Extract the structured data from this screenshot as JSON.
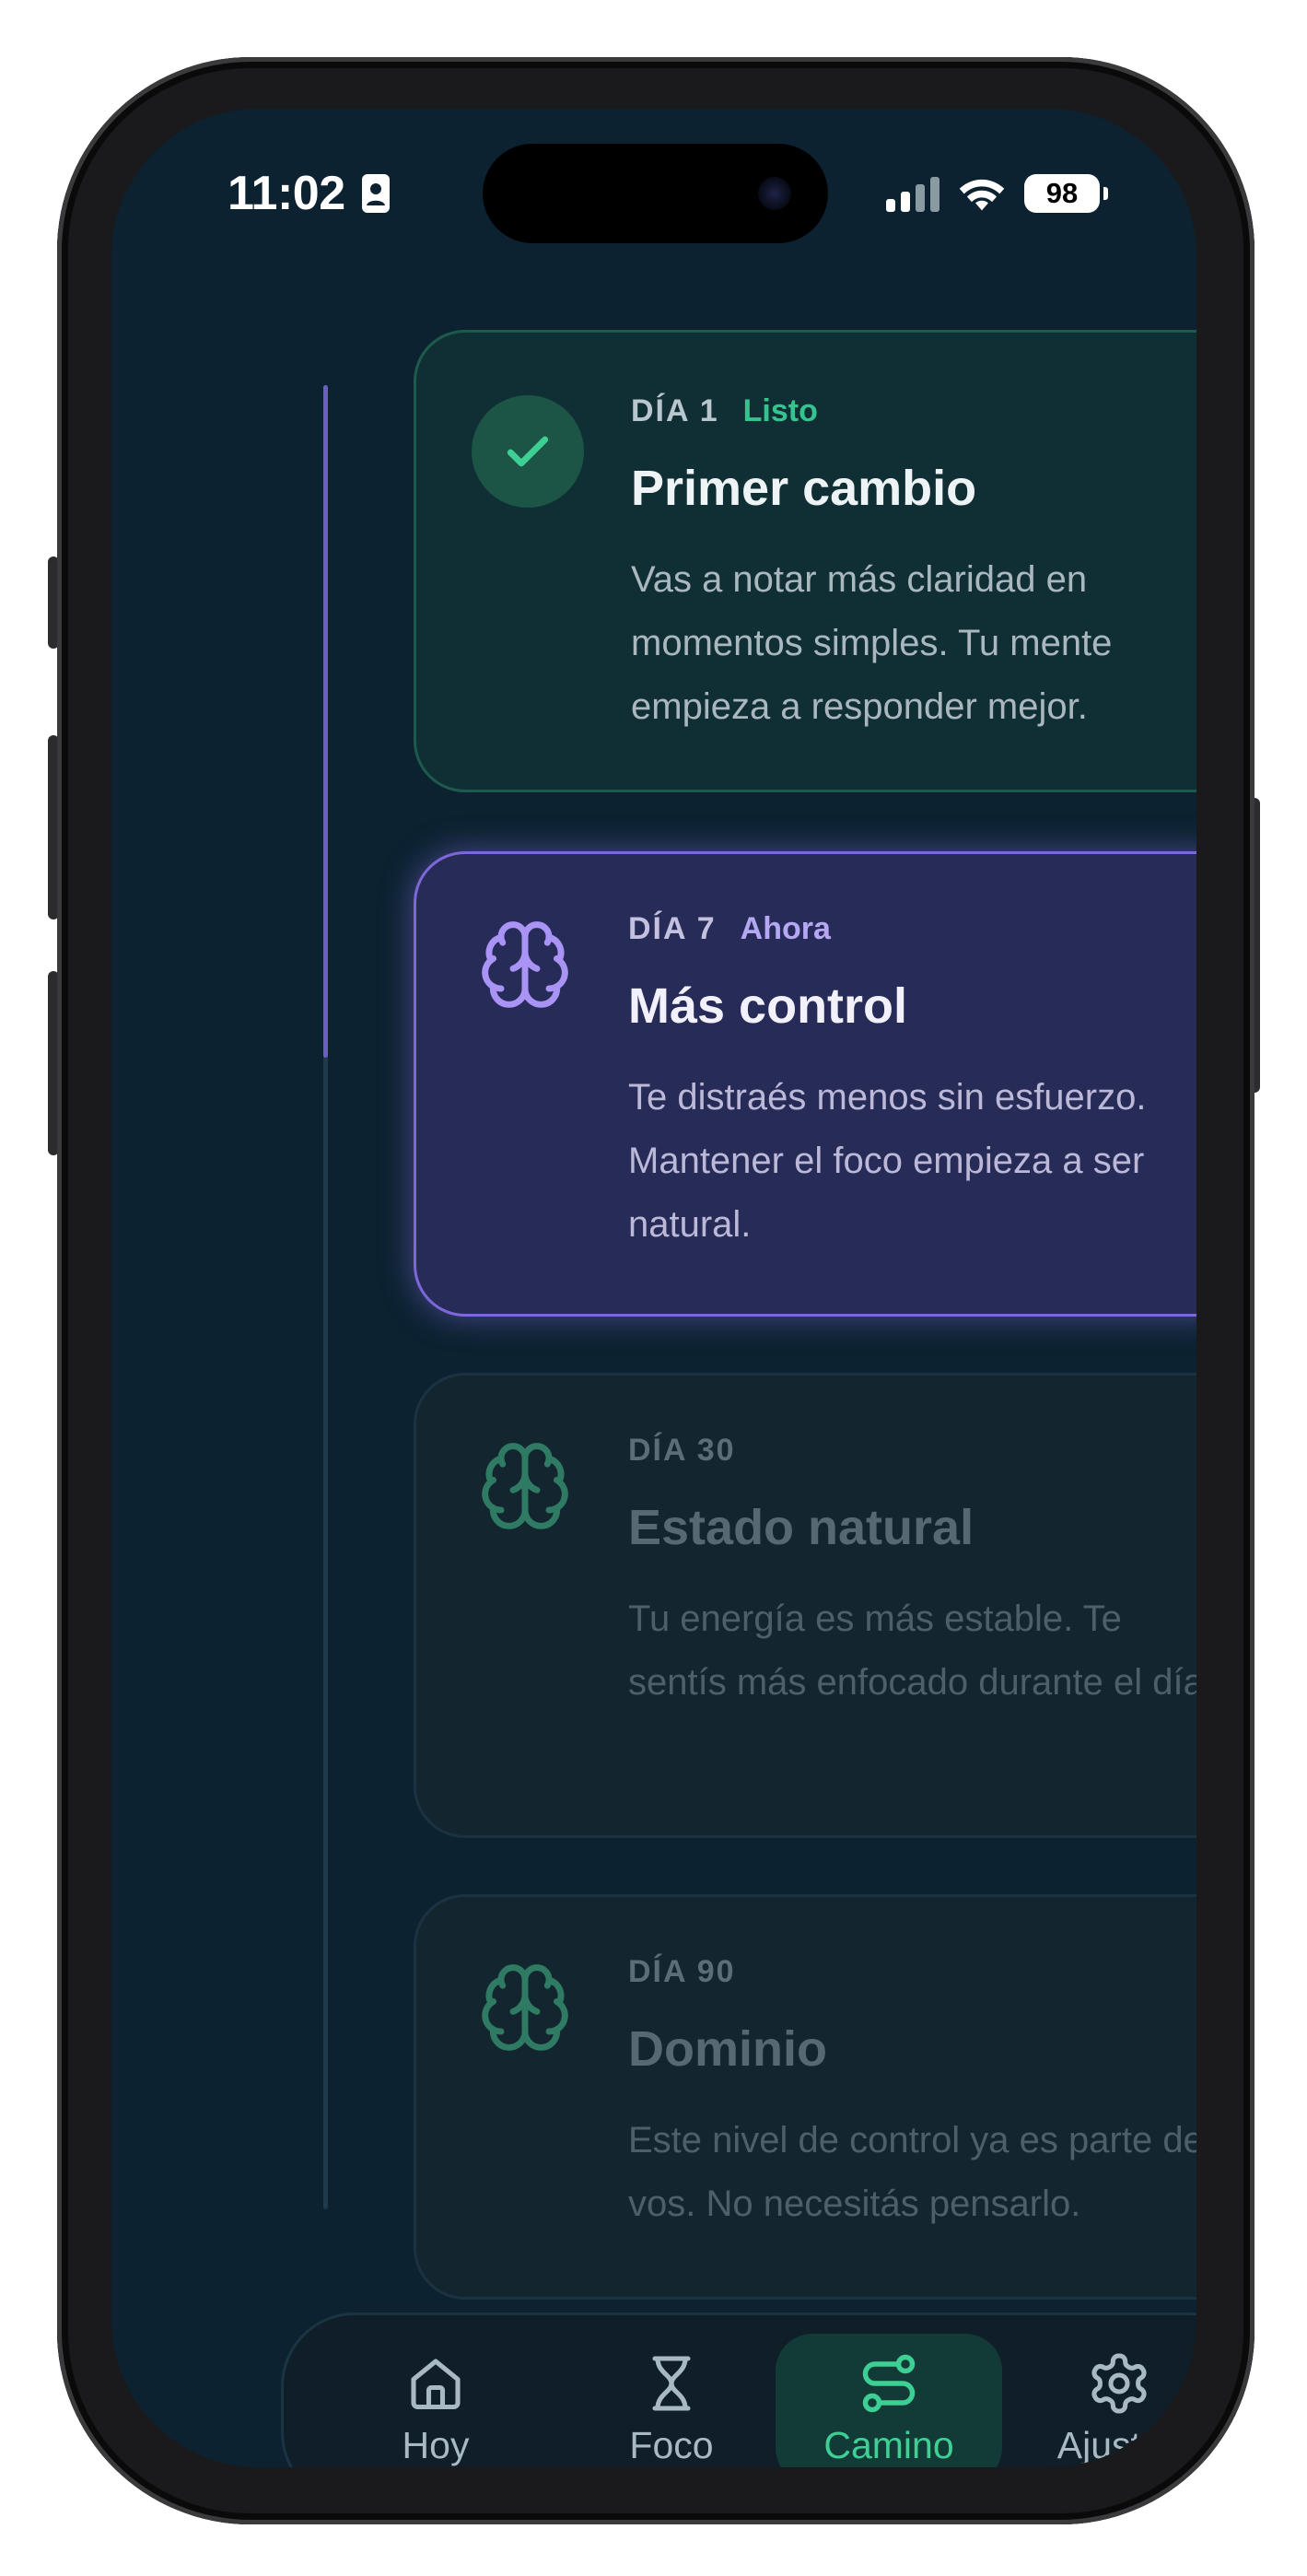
{
  "status_bar": {
    "time": "11:02",
    "battery": "98"
  },
  "timeline": [
    {
      "day": "DÍA 1",
      "tag": "Listo",
      "title": "Primer cambio",
      "description": "Vas a notar más claridad en momentos simples. Tu mente empieza a responder mejor.",
      "state": "done"
    },
    {
      "day": "DÍA 7",
      "tag": "Ahora",
      "title": "Más control",
      "description": "Te distraés menos sin esfuerzo. Mantener el foco empieza a ser natural.",
      "state": "current"
    },
    {
      "day": "DÍA 30",
      "tag": "",
      "title": "Estado natural",
      "description": "Tu energía es más estable. Te sentís más enfocado durante el día.",
      "state": "locked"
    },
    {
      "day": "DÍA 90",
      "tag": "",
      "title": "Dominio",
      "description": "Este nivel de control ya es parte de vos. No necesitás pensarlo.",
      "state": "locked"
    }
  ],
  "tabbar": {
    "tabs": [
      {
        "label": "Hoy",
        "icon": "home-icon"
      },
      {
        "label": "Foco",
        "icon": "hourglass-icon"
      },
      {
        "label": "Camino",
        "icon": "route-icon",
        "active": true
      },
      {
        "label": "Ajustes",
        "icon": "gear-icon"
      }
    ]
  },
  "colors": {
    "background": "#0c2231",
    "accent_green": "#3ecf94",
    "accent_purple": "#7e67d8",
    "done_card": "#102f35",
    "current_card": "#272b57",
    "locked_card": "#13252f"
  }
}
